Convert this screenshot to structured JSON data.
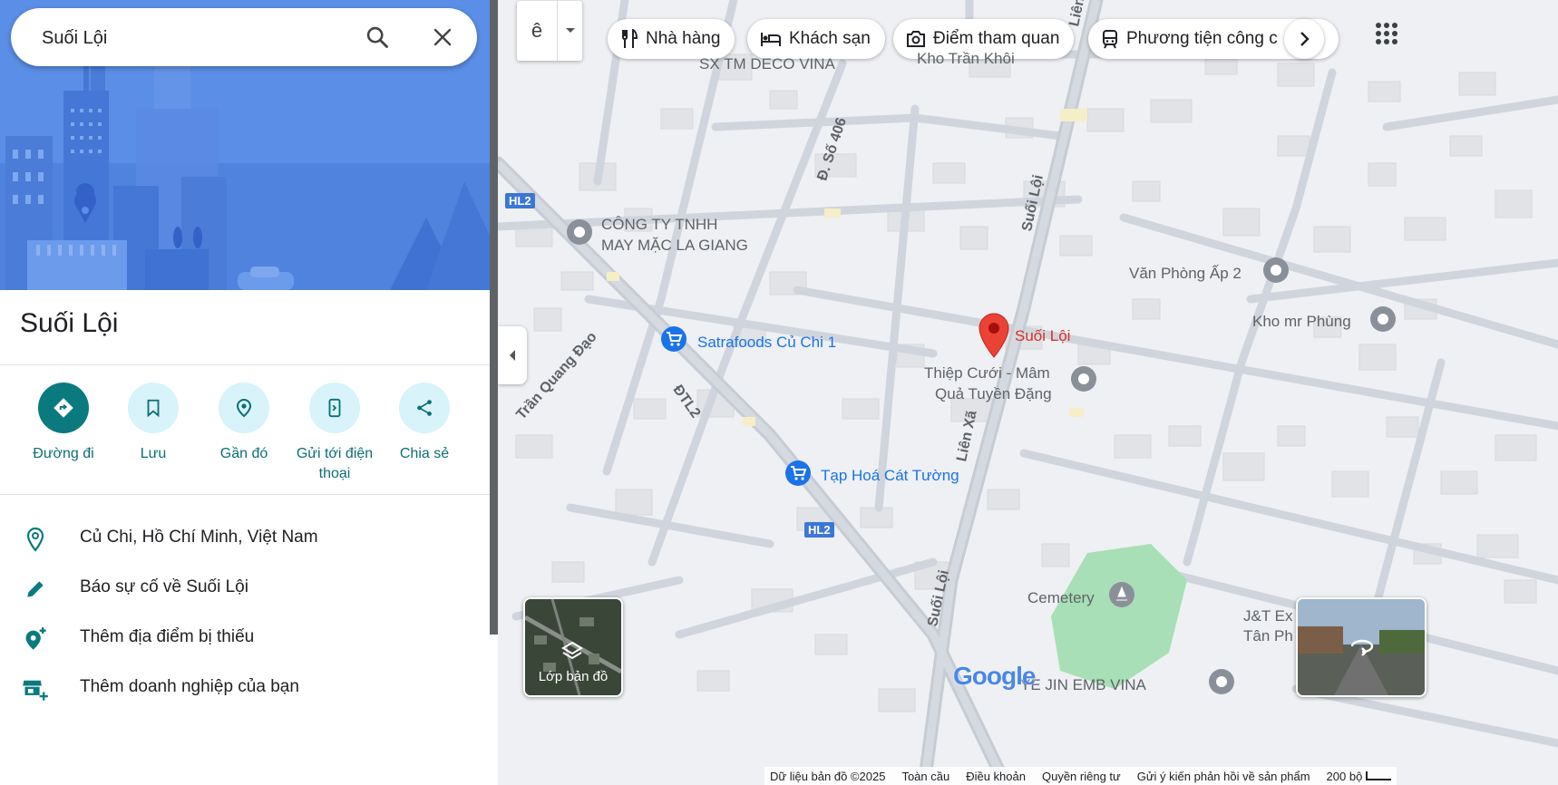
{
  "search": {
    "value": "Suối Lội"
  },
  "place": {
    "title": "Suối Lội"
  },
  "actions": [
    {
      "label": "Đường đi"
    },
    {
      "label": "Lưu"
    },
    {
      "label": "Gần đó"
    },
    {
      "label": "Gửi tới điện thoại"
    },
    {
      "label": "Chia sẻ"
    }
  ],
  "info": [
    {
      "text": "Củ Chi, Hồ Chí Minh, Việt Nam"
    },
    {
      "text": "Báo sự cố về Suối Lội"
    },
    {
      "text": "Thêm địa điểm bị thiếu"
    },
    {
      "text": "Thêm doanh nghiệp của bạn"
    }
  ],
  "map": {
    "mode_toggle": "ê",
    "chips": [
      {
        "label": "Nhà hàng",
        "icon": "restaurant-icon"
      },
      {
        "label": "Khách sạn",
        "icon": "hotel-icon"
      },
      {
        "label": "Điểm tham quan",
        "icon": "camera-icon"
      },
      {
        "label": "Phương tiện công c",
        "icon": "transit-icon"
      }
    ],
    "labels": {
      "deco": "SX TM DECO VINA",
      "tran_khoi": "Kho Trần Khôi",
      "lagiang_1": "CÔNG TY TNHH",
      "lagiang_2": "MAY MẶC LA GIANG",
      "van_phong": "Văn Phòng Ấp 2",
      "mr_phung": "Kho mr Phùng",
      "suoi_loi_pin": "Suối Lội",
      "satrafoods": "Satrafoods Củ Chi 1",
      "thiep_1": "Thiệp Cưới - Mâm",
      "thiep_2": "Quả Tuyền Đặng",
      "tap_hoa": "Tạp Hoá Cát Tường",
      "cemetery": "Cemetery",
      "jt_1": "J&T Ex",
      "jt_2": "Tân Ph",
      "yejin": "YE JIN EMB VINA"
    },
    "roads": {
      "d406": "Đ. Số 406",
      "suoi_loi_north": "Suối Lội",
      "suoi_loi_south": "Suối Lội",
      "lien_xa": "Liên Xã",
      "lien_xa_top": "Liên Xã",
      "tran_quang_dao": "Trần Quang Đạo",
      "dtl2": "ĐTL2",
      "hl2_a": "HL2",
      "hl2_b": "HL2"
    },
    "layer_label": "Lớp bản đồ",
    "logo": "Google",
    "attribution": [
      "Dữ liệu bản đồ ©2025",
      "Toàn cầu",
      "Điều khoản",
      "Quyền riêng tư",
      "Gửi ý kiến phản hồi về sản phẩm"
    ],
    "scale": "200 bộ"
  },
  "colors": {
    "accent": "#0b7a7f",
    "pin": "#ea4335",
    "poi_blue": "#1a73e8"
  }
}
